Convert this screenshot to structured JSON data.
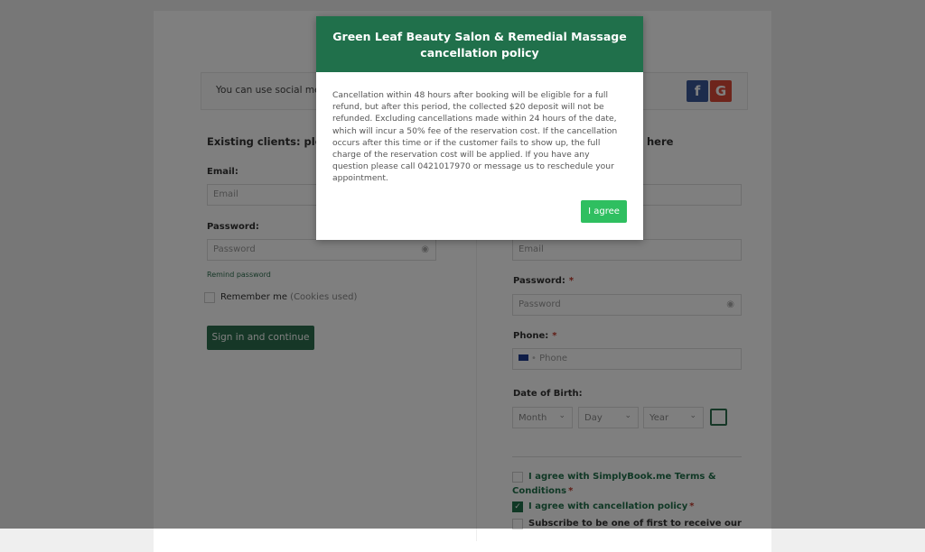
{
  "social": {
    "text": "You can use social media",
    "facebook": "f",
    "google": "G"
  },
  "login": {
    "heading": "Existing clients: please",
    "email_label": "Email:",
    "email_placeholder": "Email",
    "password_label": "Password:",
    "password_placeholder": "Password",
    "remind": "Remind password",
    "remember": "Remember me",
    "cookies": "(Cookies used)",
    "signin": "Sign in and continue"
  },
  "register": {
    "heading_fragment": "here",
    "email_placeholder": "Email",
    "password_label": "Password:",
    "password_placeholder": "Password",
    "phone_label": "Phone:",
    "phone_placeholder": "Phone",
    "dob_label": "Date of Birth:",
    "month": "Month",
    "day": "Day",
    "year": "Year",
    "required": "*",
    "terms": "I agree with SimplyBook.me Terms &",
    "terms2": "Conditions",
    "cancel_policy": "I agree with cancellation policy",
    "subscribe": "Subscribe to be one of first to receive our"
  },
  "modal": {
    "title_line1": "Green Leaf Beauty Salon & Remedial Massage",
    "title_line2": "cancellation policy",
    "body": "Cancellation within 48 hours after booking will be eligible for a full refund, but after this period, the collected $20 deposit will not be refunded. Excluding cancellations made within 24 hours of the date, which will incur a 50% fee of the reservation cost. If the cancellation occurs after this time or if the customer fails to show up, the full charge of the reservation cost will be applied. If you have any question please call 0421017970 or message us to reschedule your appointment.",
    "agree": "I agree"
  },
  "colors": {
    "brand": "#20704b",
    "agree": "#2fbf60"
  }
}
